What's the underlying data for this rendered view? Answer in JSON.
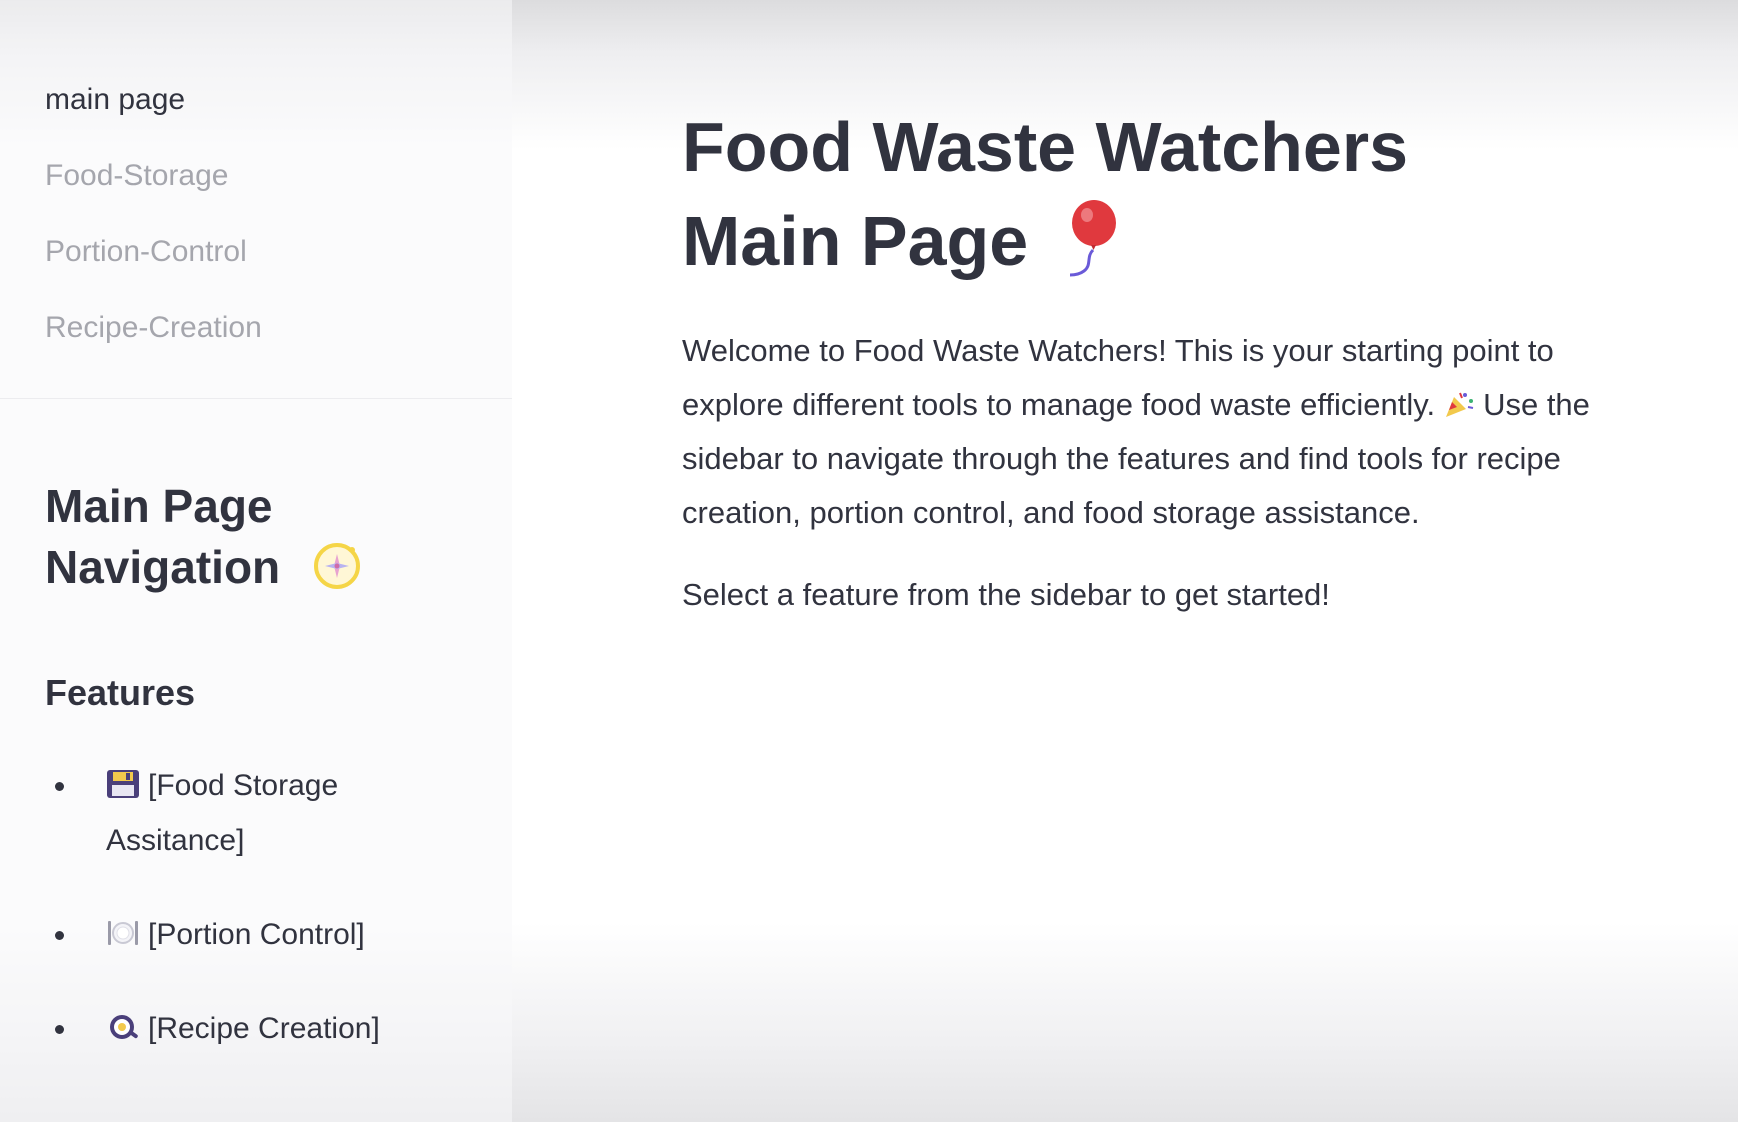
{
  "sidebar": {
    "nav_items": [
      {
        "label": "main page",
        "active": true
      },
      {
        "label": "Food-Storage",
        "active": false
      },
      {
        "label": "Portion-Control",
        "active": false
      },
      {
        "label": "Recipe-Creation",
        "active": false
      }
    ],
    "heading_line1": "Main Page",
    "heading_line2": "Navigation",
    "heading_icon": "compass-icon",
    "features_heading": "Features",
    "features": [
      {
        "icon": "floppy-disk-icon",
        "label": "[Food Storage Assitance]"
      },
      {
        "icon": "plate-cutlery-icon",
        "label": "[Portion Control]"
      },
      {
        "icon": "frying-pan-egg-icon",
        "label": "[Recipe Creation]"
      }
    ]
  },
  "main": {
    "title_line1": "Food Waste Watchers",
    "title_line2": "Main Page",
    "title_icon": "balloon-icon",
    "intro_part1": "Welcome to Food Waste Watchers! This is your starting point to explore different tools to manage food waste efficiently.",
    "intro_icon": "party-popper-icon",
    "intro_part2": "Use the sidebar to navigate through the features and find tools for recipe creation, portion control, and food storage assistance.",
    "cta": "Select a feature from the sidebar to get started!"
  },
  "colors": {
    "text": "#31333f",
    "nav_inactive": "#a5a6ad",
    "balloon": "#e0393e",
    "compass": "#f5d547"
  }
}
